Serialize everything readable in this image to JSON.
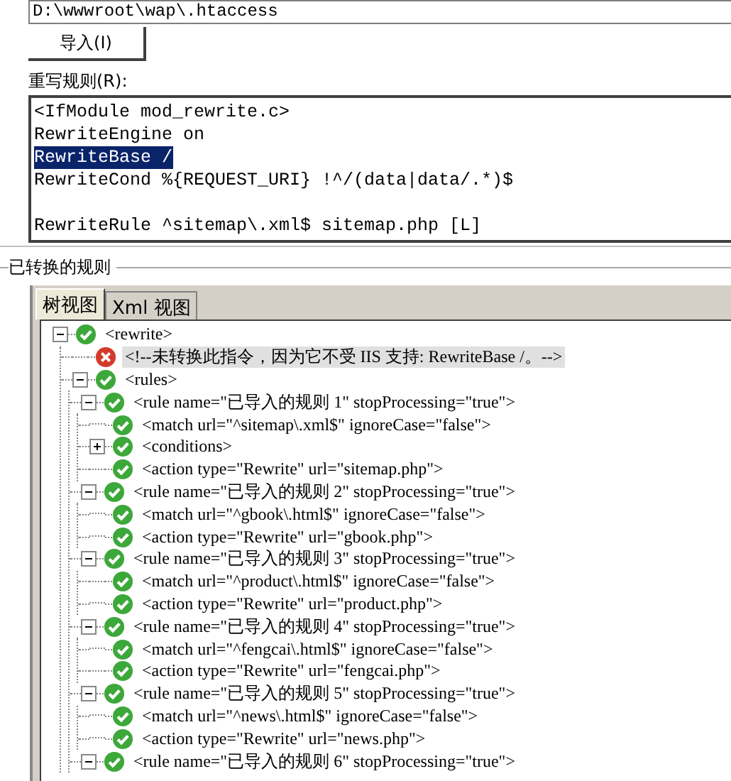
{
  "path_field": {
    "value": "D:\\wwwroot\\wap\\.htaccess"
  },
  "import_button": {
    "label": "导入(I)"
  },
  "rewrite_rules": {
    "label": "重写规则(R):",
    "blocks": [
      {
        "lines": [
          {
            "text": "<IfModule mod_rewrite.c>",
            "selected": false
          },
          {
            "text": "RewriteEngine on",
            "selected": false
          },
          {
            "text": "RewriteBase /",
            "selected": true
          },
          {
            "text": "RewriteCond %{REQUEST_URI} !^/(data|data/.*)$",
            "selected": false
          }
        ]
      },
      {
        "lines": [
          {
            "text": "RewriteRule ^sitemap\\.xml$ sitemap.php [L]",
            "selected": false
          }
        ]
      }
    ]
  },
  "converted_rules": {
    "title": "已转换的规则",
    "tabs": [
      {
        "label": "树视图",
        "selected": true
      },
      {
        "label": "Xml 视图",
        "selected": false
      }
    ],
    "tree": [
      {
        "text": "<rewrite>",
        "kind": "ok",
        "expanded": true,
        "selected": false,
        "children": [
          {
            "text": "<!--未转换此指令，因为它不受 IIS 支持: RewriteBase /。-->",
            "kind": "error",
            "selected": true
          },
          {
            "text": "<rules>",
            "kind": "ok",
            "expanded": true,
            "selected": false,
            "children": [
              {
                "text": "<rule name=\"已导入的规则 1\" stopProcessing=\"true\">",
                "kind": "ok",
                "expanded": true,
                "selected": false,
                "children": [
                  {
                    "text": "<match url=\"^sitemap\\.xml$\" ignoreCase=\"false\">",
                    "kind": "ok",
                    "selected": false
                  },
                  {
                    "text": "<conditions>",
                    "kind": "ok",
                    "expanded": false,
                    "selected": false
                  },
                  {
                    "text": "<action type=\"Rewrite\" url=\"sitemap.php\">",
                    "kind": "ok",
                    "selected": false
                  }
                ]
              },
              {
                "text": "<rule name=\"已导入的规则 2\" stopProcessing=\"true\">",
                "kind": "ok",
                "expanded": true,
                "selected": false,
                "children": [
                  {
                    "text": "<match url=\"^gbook\\.html$\" ignoreCase=\"false\">",
                    "kind": "ok",
                    "selected": false
                  },
                  {
                    "text": "<action type=\"Rewrite\" url=\"gbook.php\">",
                    "kind": "ok",
                    "selected": false
                  }
                ]
              },
              {
                "text": "<rule name=\"已导入的规则 3\" stopProcessing=\"true\">",
                "kind": "ok",
                "expanded": true,
                "selected": false,
                "children": [
                  {
                    "text": "<match url=\"^product\\.html$\" ignoreCase=\"false\">",
                    "kind": "ok",
                    "selected": false
                  },
                  {
                    "text": "<action type=\"Rewrite\" url=\"product.php\">",
                    "kind": "ok",
                    "selected": false
                  }
                ]
              },
              {
                "text": "<rule name=\"已导入的规则 4\" stopProcessing=\"true\">",
                "kind": "ok",
                "expanded": true,
                "selected": false,
                "children": [
                  {
                    "text": "<match url=\"^fengcai\\.html$\" ignoreCase=\"false\">",
                    "kind": "ok",
                    "selected": false
                  },
                  {
                    "text": "<action type=\"Rewrite\" url=\"fengcai.php\">",
                    "kind": "ok",
                    "selected": false
                  }
                ]
              },
              {
                "text": "<rule name=\"已导入的规则 5\" stopProcessing=\"true\">",
                "kind": "ok",
                "expanded": true,
                "selected": false,
                "children": [
                  {
                    "text": "<match url=\"^news\\.html$\" ignoreCase=\"false\">",
                    "kind": "ok",
                    "selected": false
                  },
                  {
                    "text": "<action type=\"Rewrite\" url=\"news.php\">",
                    "kind": "ok",
                    "selected": false
                  }
                ]
              },
              {
                "text": "<rule name=\"已导入的规则 6\" stopProcessing=\"true\">",
                "kind": "ok",
                "expanded": true,
                "selected": false
              }
            ]
          }
        ]
      }
    ]
  }
}
